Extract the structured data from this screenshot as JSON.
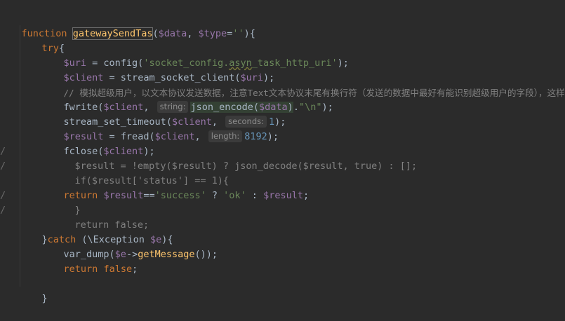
{
  "code": {
    "l1": {
      "kw": "function",
      "name": "gatewaySendTas",
      "p1": "(",
      "v1": "$data",
      "sep": ", ",
      "v2": "$type",
      "eq": "=",
      "s1": "''",
      "p2": "){"
    },
    "l2": {
      "kw": "try",
      "br": "{"
    },
    "l3": {
      "v": "$uri",
      "op": " = config(",
      "s_pre": "'socket_config.",
      "s_sq": "asyn",
      "s_post": "_task_http_uri'",
      "end": ");"
    },
    "l4": {
      "v": "$client",
      "op": " = stream_socket_client(",
      "v2": "$uri",
      "end": ");"
    },
    "l5": {
      "text": "// 模拟超级用户，以文本协议发送数据，注意Text文本协议末尾有换行符（发送的数据中最好有能识别超级用户的字段），这样在"
    },
    "l6": {
      "fn": "fwrite(",
      "v": "$client",
      "comma": ", ",
      "hint": "string:",
      "call": "json_encode(",
      "v2": "$data",
      "close": ")",
      "dot": ".",
      "s": "\"\\n\"",
      "end": ");"
    },
    "l7": {
      "fn": "stream_set_timeout(",
      "v": "$client",
      "comma": ", ",
      "hint": "seconds:",
      "n": "1",
      "end": ");"
    },
    "l8": {
      "v": "$result",
      "op": " = fread(",
      "v2": "$client",
      "comma": ", ",
      "hint": "length:",
      "n": "8192",
      "end": ");"
    },
    "l9": {
      "fn": "fclose(",
      "v": "$client",
      "end": ");"
    },
    "l10": {
      "mark": "/",
      "text": "$result = !empty($result) ? json_decode($result, true) : [];"
    },
    "l11": {
      "mark": "/",
      "text": "if($result['status'] == 1){"
    },
    "l12": {
      "kw": "return",
      "v": "$result",
      "op": "==",
      "s1": "'success'",
      "q": " ? ",
      "s2": "'ok'",
      "c": " : ",
      "v2": "$result",
      "end": ";"
    },
    "l13": {
      "mark": "/",
      "text": "}"
    },
    "l14": {
      "mark": "/",
      "text": "return false;"
    },
    "l15": {
      "br": "}",
      "kw": "catch",
      "p": " (\\Exception ",
      "v": "$e",
      "end": "){"
    },
    "l16": {
      "fn": "var_dump(",
      "v": "$e",
      "arrow": "->",
      "m": "getMessage",
      "end": "());"
    },
    "l17": {
      "kw": "return",
      "kw2": "false",
      "end": ";"
    },
    "l18": {
      "br": "}"
    }
  }
}
